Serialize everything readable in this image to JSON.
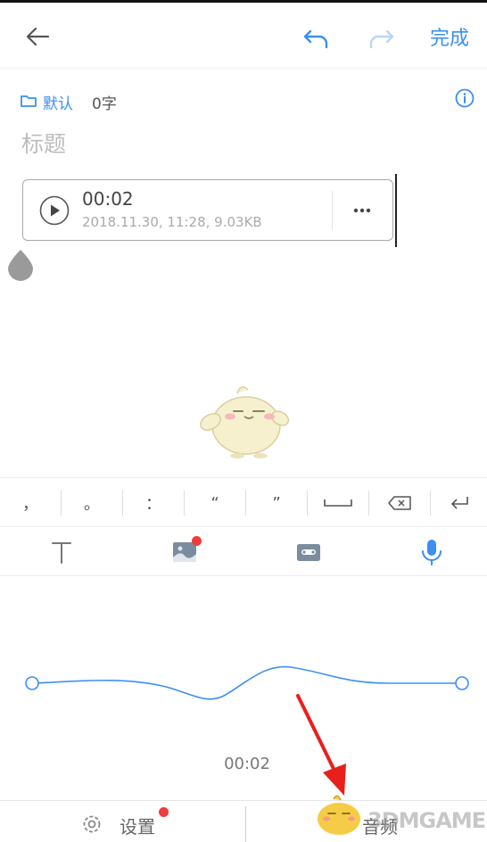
{
  "header": {
    "done_label": "完成"
  },
  "note": {
    "category": "默认",
    "word_count": "0字",
    "title_placeholder": "标题"
  },
  "audio_attachment": {
    "duration": "00:02",
    "meta": "2018.11.30, 11:28, 9.03KB"
  },
  "punctuation_keys": [
    "，",
    "。",
    "：",
    "“",
    "”"
  ],
  "recorder": {
    "elapsed": "00:02"
  },
  "bottom_bar": {
    "settings_label": "设置",
    "save_label": "音频"
  },
  "watermark": "3DMGAME",
  "colors": {
    "accent": "#3b8ff0",
    "badge": "#f03c3c",
    "arrow": "#e8201c"
  },
  "icons": [
    "back-arrow-icon",
    "undo-icon",
    "redo-icon",
    "folder-icon",
    "info-icon",
    "play-icon",
    "more-dots-icon",
    "space-icon",
    "backspace-icon",
    "enter-icon",
    "text-format-icon",
    "image-icon",
    "cassette-icon",
    "microphone-icon",
    "gear-icon"
  ]
}
